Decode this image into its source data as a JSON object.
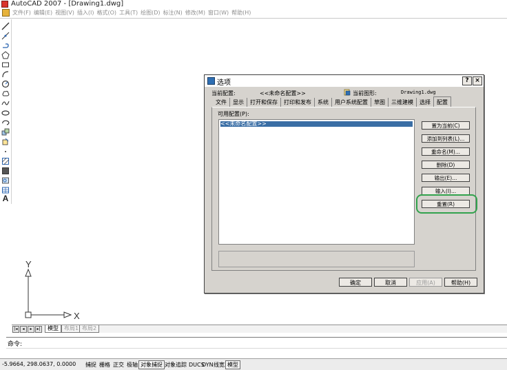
{
  "window": {
    "title": "AutoCAD 2007 - [Drawing1.dwg]"
  },
  "menu": {
    "items": [
      "文件(F)",
      "编辑(E)",
      "视图(V)",
      "插入(I)",
      "格式(O)",
      "工具(T)",
      "绘图(D)",
      "标注(N)",
      "修改(M)",
      "窗口(W)",
      "帮助(H)"
    ]
  },
  "toolbar": {
    "text_tool": "A"
  },
  "ucs": {
    "x_label": "X",
    "y_label": "Y"
  },
  "layout_tabs": [
    "模型",
    "布局1",
    "布局2"
  ],
  "command": {
    "prompt": "命令:"
  },
  "status": {
    "coords": "-5.9664,  298.0637, 0.0000",
    "buttons": [
      "捕捉",
      "栅格",
      "正交",
      "极轴",
      "对象捕捉",
      "对象追踪",
      "DUCS",
      "DYN",
      "线宽",
      "模型"
    ]
  },
  "dialog": {
    "title": "选项",
    "help_btn": "?",
    "close_btn": "×",
    "current_profile_label": "当前配置:",
    "current_profile_value": "<<未命名配置>>",
    "current_drawing_label": "当前图形:",
    "current_drawing_value": "Drawing1.dwg",
    "tabs": [
      "文件",
      "显示",
      "打开和保存",
      "打印和发布",
      "系统",
      "用户系统配置",
      "草图",
      "三维建模",
      "选择",
      "配置"
    ],
    "active_tab": "配置",
    "available_label": "可用配置(P):",
    "profiles": [
      "<<未命名配置>>"
    ],
    "side_buttons": [
      "置为当前(C)",
      "添加到列表(L)...",
      "重命名(M)...",
      "删除(D)",
      "输出(E)...",
      "输入(I)...",
      "重置(R)"
    ],
    "ok": "确定",
    "cancel": "取消",
    "apply": "应用(A)",
    "help": "帮助(H)"
  }
}
